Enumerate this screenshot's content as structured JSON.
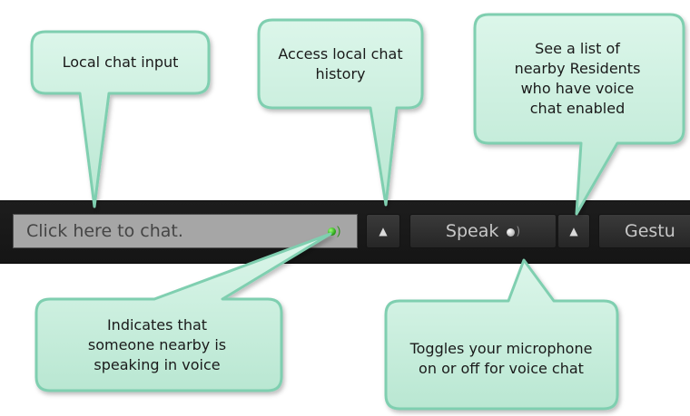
{
  "toolbar": {
    "chat_placeholder": "Click here to chat.",
    "speak_label": "Speak",
    "gestures_label": "Gestu",
    "icons": [
      "chevron-up-icon",
      "voice-indicator-icon",
      "microphone-status-icon"
    ]
  },
  "callouts": {
    "chat_input": "Local chat input",
    "chat_history": "Access local chat history",
    "nearby_voice": "See a list of nearby Residents who have voice chat enabled",
    "speaking_indicator": "Indicates that someone nearby is speaking in voice",
    "mic_toggle": "Toggles your microphone on or off for voice chat"
  },
  "colors": {
    "callout_fill": "#c6eedd",
    "callout_border": "#7fcfb0",
    "toolbar_bg": "#1a1a1a",
    "voice_active": "#3ec72a"
  }
}
